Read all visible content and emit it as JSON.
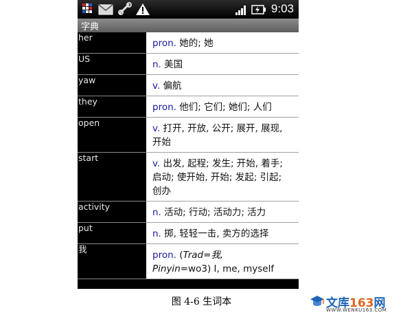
{
  "status_bar": {
    "time": "9:03",
    "icons": [
      "notification-grid-icon",
      "envelope-icon",
      "usb-debug-icon",
      "warning-icon",
      "signal-icon",
      "battery-icon"
    ]
  },
  "app": {
    "title": "字典"
  },
  "entries": [
    {
      "word": "her",
      "pos": "pron.",
      "def": " 她的; 她"
    },
    {
      "word": "US",
      "pos": "n.",
      "def": " 美国"
    },
    {
      "word": "yaw",
      "pos": "v.",
      "def": " 偏航"
    },
    {
      "word": "they",
      "pos": "pron.",
      "def": " 他们; 它们; 她们; 人们"
    },
    {
      "word": "open",
      "pos": "v.",
      "def": " 打开, 开放, 公开; 展开, 展现, 开始"
    },
    {
      "word": "start",
      "pos": "v.",
      "def": " 出发, 起程; 发生; 开始, 着手; 启动; 使开始, 开始; 发起; 引起; 创办"
    },
    {
      "word": "activity",
      "pos": "n.",
      "def": " 活动; 行动; 活动力; 活力"
    },
    {
      "word": "put",
      "pos": "n.",
      "def": " 掷, 轻轻一击, 卖方的选择"
    },
    {
      "word": "我",
      "pos": "pron.",
      "def_parts": {
        "open": " (",
        "trad_label": "Trad",
        "trad_value": "=我,",
        "pinyin_label": "Pinyin",
        "pinyin_value": "=wo3) I, me, myself"
      }
    }
  ],
  "caption": "图 4-6 生词本",
  "watermark": {
    "name": "文库",
    "number": "163",
    "suffix": "网",
    "url": "WWW.WENKU163.COM"
  }
}
